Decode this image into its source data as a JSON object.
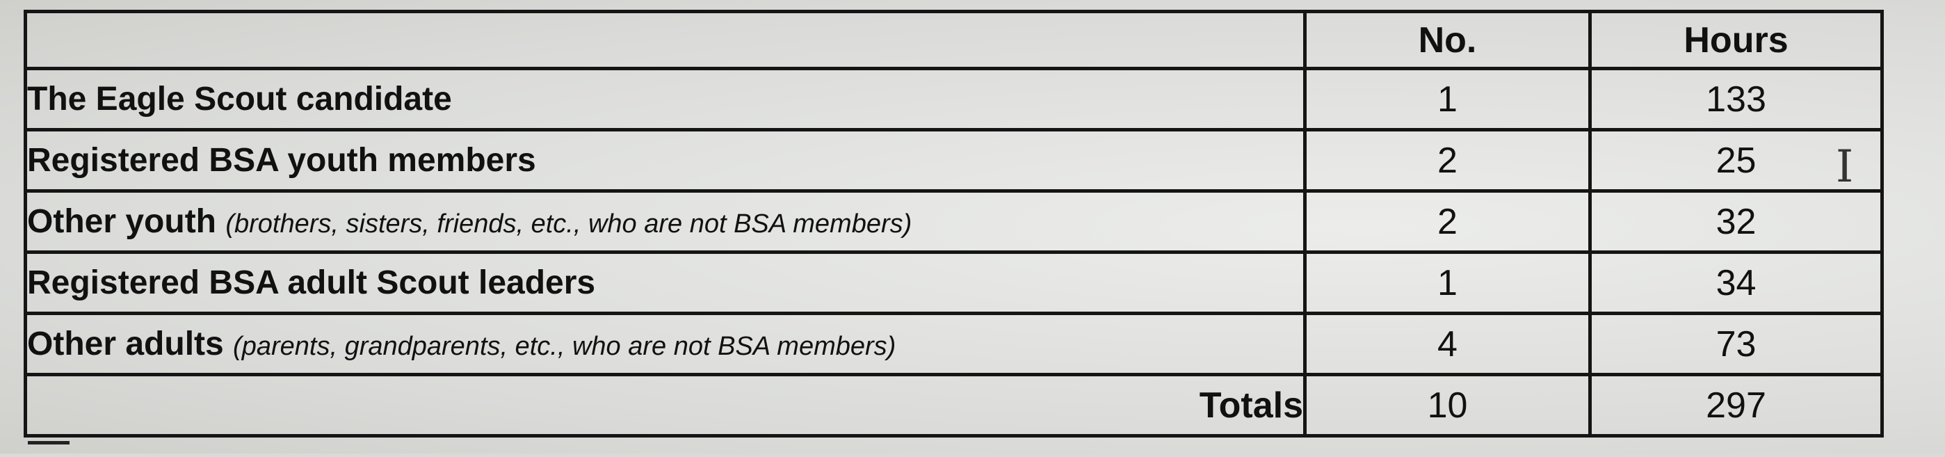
{
  "table": {
    "headers": [
      "",
      "No.",
      "Hours"
    ],
    "rows": [
      {
        "label": "The Eagle Scout candidate",
        "note": "",
        "no": "1",
        "hours": "133"
      },
      {
        "label": "Registered BSA youth members",
        "note": "",
        "no": "2",
        "hours": "25"
      },
      {
        "label": "Other youth",
        "note": "(brothers, sisters, friends, etc., who are not BSA members)",
        "no": "2",
        "hours": "32"
      },
      {
        "label": "Registered BSA adult Scout leaders",
        "note": "",
        "no": "1",
        "hours": "34"
      },
      {
        "label": "Other adults",
        "note": "(parents, grandparents, etc., who are not BSA members)",
        "no": "4",
        "hours": "73"
      }
    ],
    "totals": {
      "label": "Totals",
      "no": "10",
      "hours": "297"
    }
  },
  "cursor_icon": "text-cursor-icon"
}
